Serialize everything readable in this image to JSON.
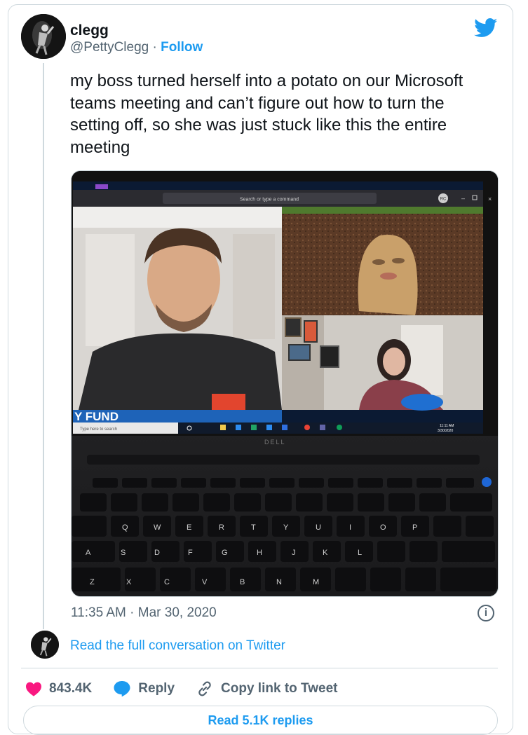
{
  "author": {
    "name": "clegg",
    "handle": "@PettyClegg",
    "separator": " · ",
    "follow_label": "Follow"
  },
  "tweet": {
    "text": "my boss turned herself into a potato on our Microsoft\nteams meeting and can’t figure out how to turn the\nsetting off, so she was just stuck like this the entire\nmeeting",
    "timestamp": "11:35 AM · Mar 30, 2020"
  },
  "photo": {
    "teams_search": "Search or type a command",
    "teams_initials": "RC",
    "win_search": "Type here to search",
    "tray_time": "11:11 AM",
    "tray_date": "3/30/2020",
    "banner_text": "Y FUND",
    "laptop_brand": "DELL",
    "keys_row1": [
      "Q",
      "W",
      "E",
      "R",
      "T",
      "Y",
      "U",
      "I",
      "O",
      "P"
    ],
    "keys_row2": [
      "A",
      "S",
      "D",
      "F",
      "G",
      "H",
      "J",
      "K",
      "L"
    ],
    "keys_row3": [
      "Z",
      "X",
      "C",
      "V",
      "B",
      "N",
      "M"
    ]
  },
  "thread": {
    "read_full": "Read the full conversation on Twitter"
  },
  "actions": {
    "likes": "843.4K",
    "reply": "Reply",
    "copy_link": "Copy link to Tweet"
  },
  "replies_button": "Read 5.1K replies",
  "colors": {
    "accent": "#1d9bf0",
    "like": "#f91880",
    "secondary_text": "#536471",
    "border": "#cfd9de"
  },
  "icons": [
    "twitter-bird-icon",
    "info-icon",
    "heart-icon",
    "reply-bubble-icon",
    "link-icon"
  ]
}
